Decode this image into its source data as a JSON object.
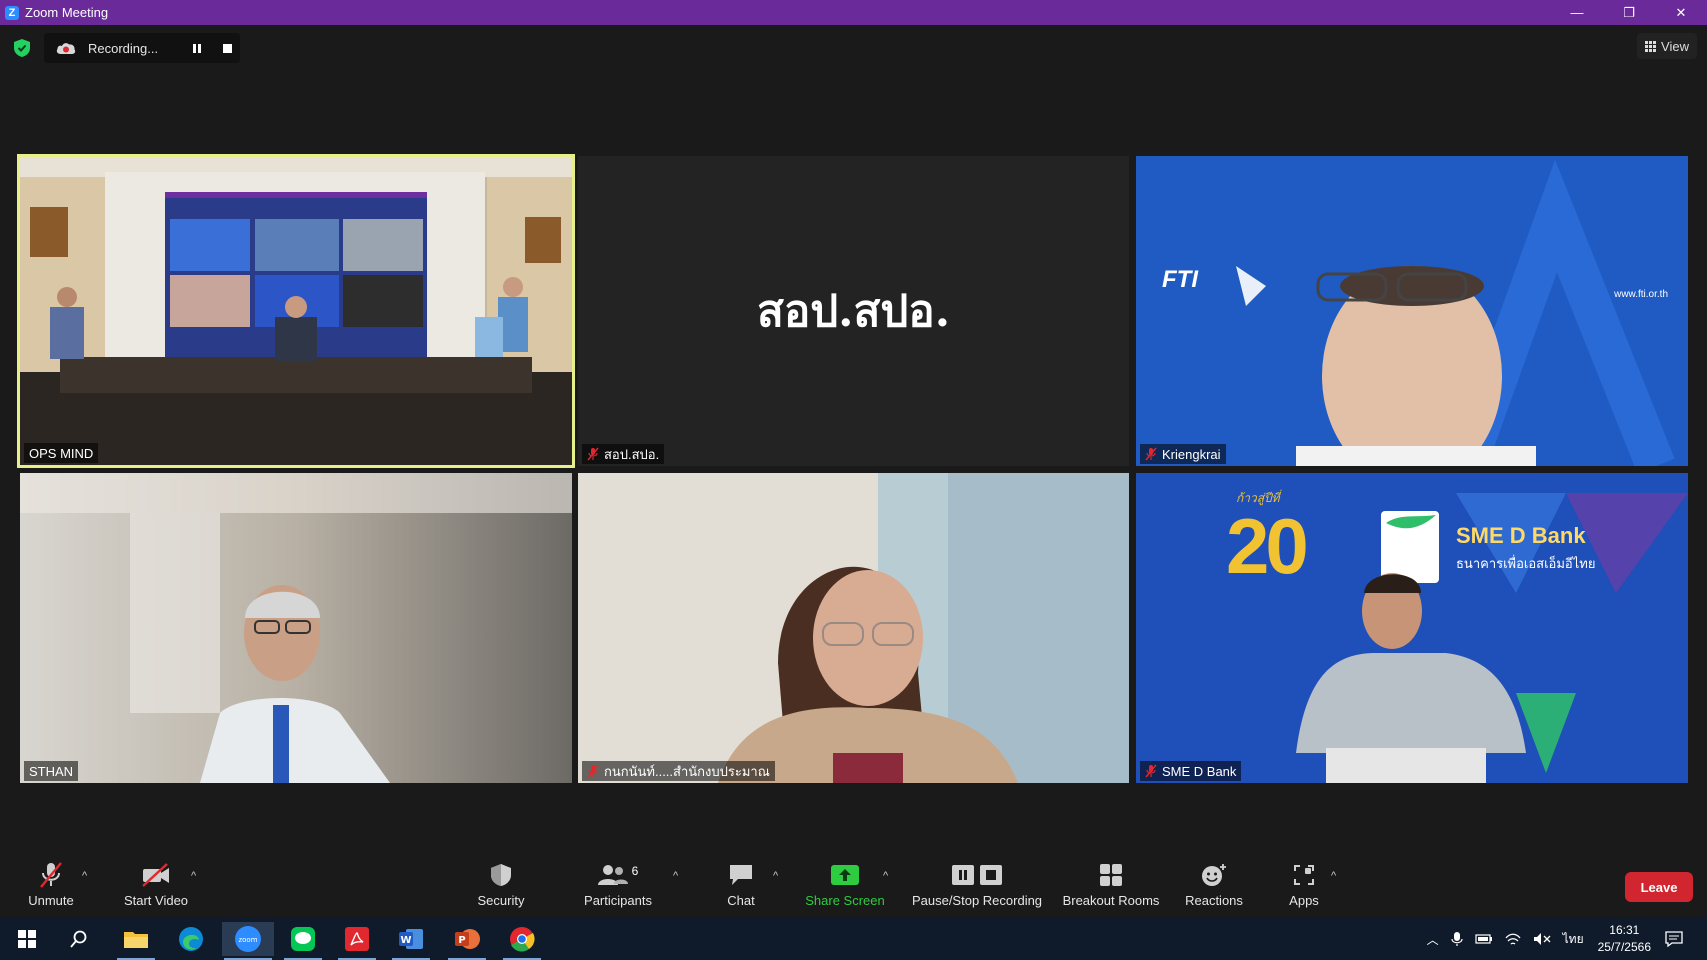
{
  "window": {
    "title": "Zoom Meeting",
    "minimize": "—",
    "restore": "❐",
    "close": "✕"
  },
  "recording": {
    "label": "Recording..."
  },
  "view": {
    "label": "View"
  },
  "tiles": [
    {
      "name": "OPS MIND"
    },
    {
      "name": "สอป.สปอ.",
      "big_name": "สอป.สปอ."
    },
    {
      "name": "Kriengkrai",
      "logo": "FTI",
      "url": "www.fti.or.th"
    },
    {
      "name": "STHAN"
    },
    {
      "name": "กนกนันท์.....สำนักงบประมาณ"
    },
    {
      "name": "SME D Bank",
      "bank_title": "SME D Bank",
      "bank_subtitle": "ธนาคารเพื่อเอสเอ็มอีไทย",
      "anniv": "20",
      "anniv_prefix": "ก้าวสู่ปีที่"
    }
  ],
  "toolbar": {
    "unmute": "Unmute",
    "start_video": "Start Video",
    "security": "Security",
    "participants": "Participants",
    "participants_count": "6",
    "chat": "Chat",
    "share_screen": "Share Screen",
    "pause_stop": "Pause/Stop Recording",
    "breakout": "Breakout Rooms",
    "reactions": "Reactions",
    "apps": "Apps",
    "leave": "Leave"
  },
  "taskbar": {
    "lang": "ไทย",
    "time": "16:31",
    "date": "25/7/2566",
    "zoom_label": "zoom"
  },
  "colors": {
    "title_bar": "#6b2a9a",
    "active_border": "#e6f08a",
    "leave": "#d1262f",
    "share_green": "#2ecc40"
  }
}
